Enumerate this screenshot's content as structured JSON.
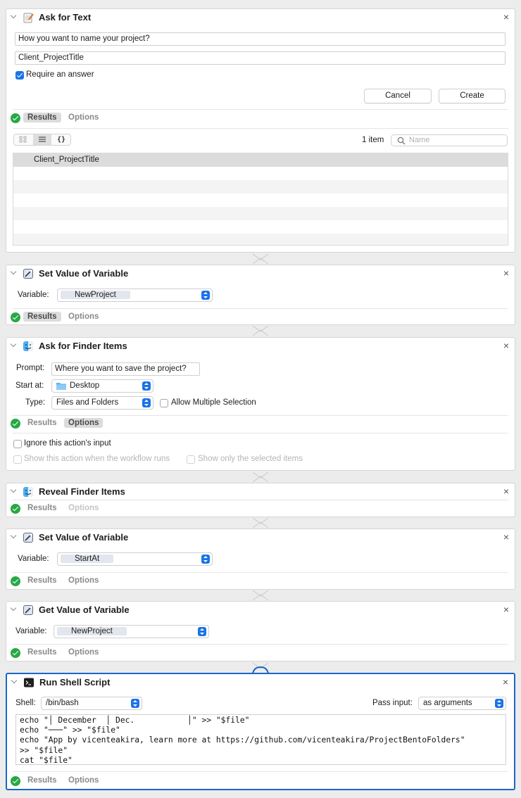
{
  "connector_color": "#c9c9c9",
  "accent": "#1a73e8",
  "status_color": "#27a844",
  "actions": {
    "ask_text": {
      "title": "Ask for Text",
      "icon": "notepad-icon",
      "question": "How you want to name your project?",
      "default_answer": "Client_ProjectTitle",
      "require_answer_label": "Require an answer",
      "require_answer_checked": true,
      "cancel_label": "Cancel",
      "create_label": "Create",
      "results_tab": "Results",
      "options_tab": "Options",
      "item_count": "1 item",
      "search_placeholder": "Name",
      "view_icons": [
        "grid-icon",
        "list-icon",
        "braces-icon"
      ],
      "view_glyphs": {
        "braces": "{}"
      },
      "results": [
        "Client_ProjectTitle"
      ]
    },
    "set_var_1": {
      "title": "Set Value of Variable",
      "icon": "variable-wand-icon",
      "variable_label": "Variable:",
      "variable_value": "NewProject",
      "results_tab": "Results",
      "options_tab": "Options"
    },
    "ask_finder": {
      "title": "Ask for Finder Items",
      "icon": "finder-icon",
      "prompt_label": "Prompt:",
      "prompt_value": "Where you want to save the project?",
      "start_label": "Start at:",
      "start_value": "Desktop",
      "type_label": "Type:",
      "type_value": "Files and Folders",
      "allow_multiple_label": "Allow Multiple Selection",
      "results_tab": "Results",
      "options_tab": "Options",
      "ignore_input_label": "Ignore this action's input",
      "show_action_label": "Show this action when the workflow runs",
      "show_selected_label": "Show only the selected items"
    },
    "reveal_finder": {
      "title": "Reveal Finder Items",
      "icon": "finder-icon",
      "results_tab": "Results",
      "options_tab": "Options"
    },
    "set_var_2": {
      "title": "Set Value of Variable",
      "icon": "variable-wand-icon",
      "variable_label": "Variable:",
      "variable_value": "StartAt",
      "results_tab": "Results",
      "options_tab": "Options"
    },
    "get_var": {
      "title": "Get Value of Variable",
      "icon": "variable-wand-icon",
      "variable_label": "Variable:",
      "variable_value": "NewProject",
      "results_tab": "Results",
      "options_tab": "Options"
    },
    "shell": {
      "title": "Run Shell Script",
      "icon": "terminal-icon",
      "shell_label": "Shell:",
      "shell_value": "/bin/bash",
      "pass_input_label": "Pass input:",
      "pass_input_value": "as arguments",
      "script": "echo \"│ December  │ Dec.           │\" >> \"$file\"\necho \"───\" >> \"$file\"\necho \"App by vicenteakira, learn more at https://github.com/vicenteakira/ProjectBentoFolders\"\n>> \"$file\"\ncat \"$file\"",
      "results_tab": "Results",
      "options_tab": "Options"
    }
  }
}
